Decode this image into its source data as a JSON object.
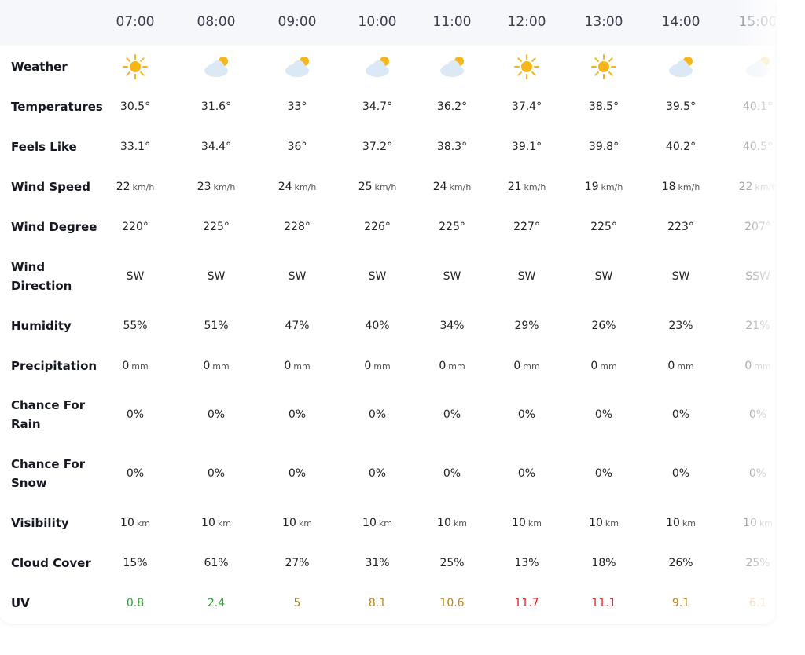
{
  "hours": [
    "07:00",
    "08:00",
    "09:00",
    "10:00",
    "11:00",
    "12:00",
    "13:00",
    "14:00",
    "15:00"
  ],
  "row_labels": {
    "weather": "Weather",
    "temperatures": "Temperatures",
    "feels_like": "Feels Like",
    "wind_speed": "Wind Speed",
    "wind_degree": "Wind Degree",
    "wind_direction": [
      "Wind",
      "Direction"
    ],
    "humidity": "Humidity",
    "precipitation": "Precipitation",
    "chance_rain": [
      "Chance For",
      "Rain"
    ],
    "chance_snow": [
      "Chance For",
      "Snow"
    ],
    "visibility": "Visibility",
    "cloud_cover": "Cloud Cover",
    "uv": "UV"
  },
  "weather_icons": [
    "sun-icon",
    "partly-cloudy-icon",
    "partly-cloudy-icon",
    "partly-cloudy-icon",
    "partly-cloudy-icon",
    "sun-icon",
    "sun-icon",
    "partly-cloudy-icon",
    "partly-cloudy-icon"
  ],
  "temperatures": [
    "30.5°",
    "31.6°",
    "33°",
    "34.7°",
    "36.2°",
    "37.4°",
    "38.5°",
    "39.5°",
    "40.1°"
  ],
  "feels_like": [
    "33.1°",
    "34.4°",
    "36°",
    "37.2°",
    "38.3°",
    "39.1°",
    "39.8°",
    "40.2°",
    "40.5°"
  ],
  "wind_speed": [
    "22",
    "23",
    "24",
    "25",
    "24",
    "21",
    "19",
    "18",
    "22"
  ],
  "wind_speed_unit": "km/h",
  "wind_degree": [
    "220°",
    "225°",
    "228°",
    "226°",
    "225°",
    "227°",
    "225°",
    "223°",
    "207°"
  ],
  "wind_direction": [
    "SW",
    "SW",
    "SW",
    "SW",
    "SW",
    "SW",
    "SW",
    "SW",
    "SSW"
  ],
  "humidity": [
    "55%",
    "51%",
    "47%",
    "40%",
    "34%",
    "29%",
    "26%",
    "23%",
    "21%"
  ],
  "precipitation": [
    "0",
    "0",
    "0",
    "0",
    "0",
    "0",
    "0",
    "0",
    "0"
  ],
  "precipitation_unit": "mm",
  "chance_rain": [
    "0%",
    "0%",
    "0%",
    "0%",
    "0%",
    "0%",
    "0%",
    "0%",
    "0%"
  ],
  "chance_snow": [
    "0%",
    "0%",
    "0%",
    "0%",
    "0%",
    "0%",
    "0%",
    "0%",
    "0%"
  ],
  "visibility": [
    "10",
    "10",
    "10",
    "10",
    "10",
    "10",
    "10",
    "10",
    "10"
  ],
  "visibility_unit": "km",
  "cloud_cover": [
    "15%",
    "61%",
    "27%",
    "31%",
    "25%",
    "13%",
    "18%",
    "26%",
    "25%"
  ],
  "uv": [
    "0.8",
    "2.4",
    "5",
    "8.1",
    "10.6",
    "11.7",
    "11.1",
    "9.1",
    "6.1"
  ],
  "uv_colors": [
    "#2e9d35",
    "#2e9d35",
    "#9a8a12",
    "#b8861b",
    "#b8861b",
    "#e0262c",
    "#e0262c",
    "#b8861b",
    "#e0a030"
  ],
  "colors": {
    "sun": "#f6b519",
    "cloud": "#dbe8f6",
    "header_bg": "#f6f7fb"
  }
}
